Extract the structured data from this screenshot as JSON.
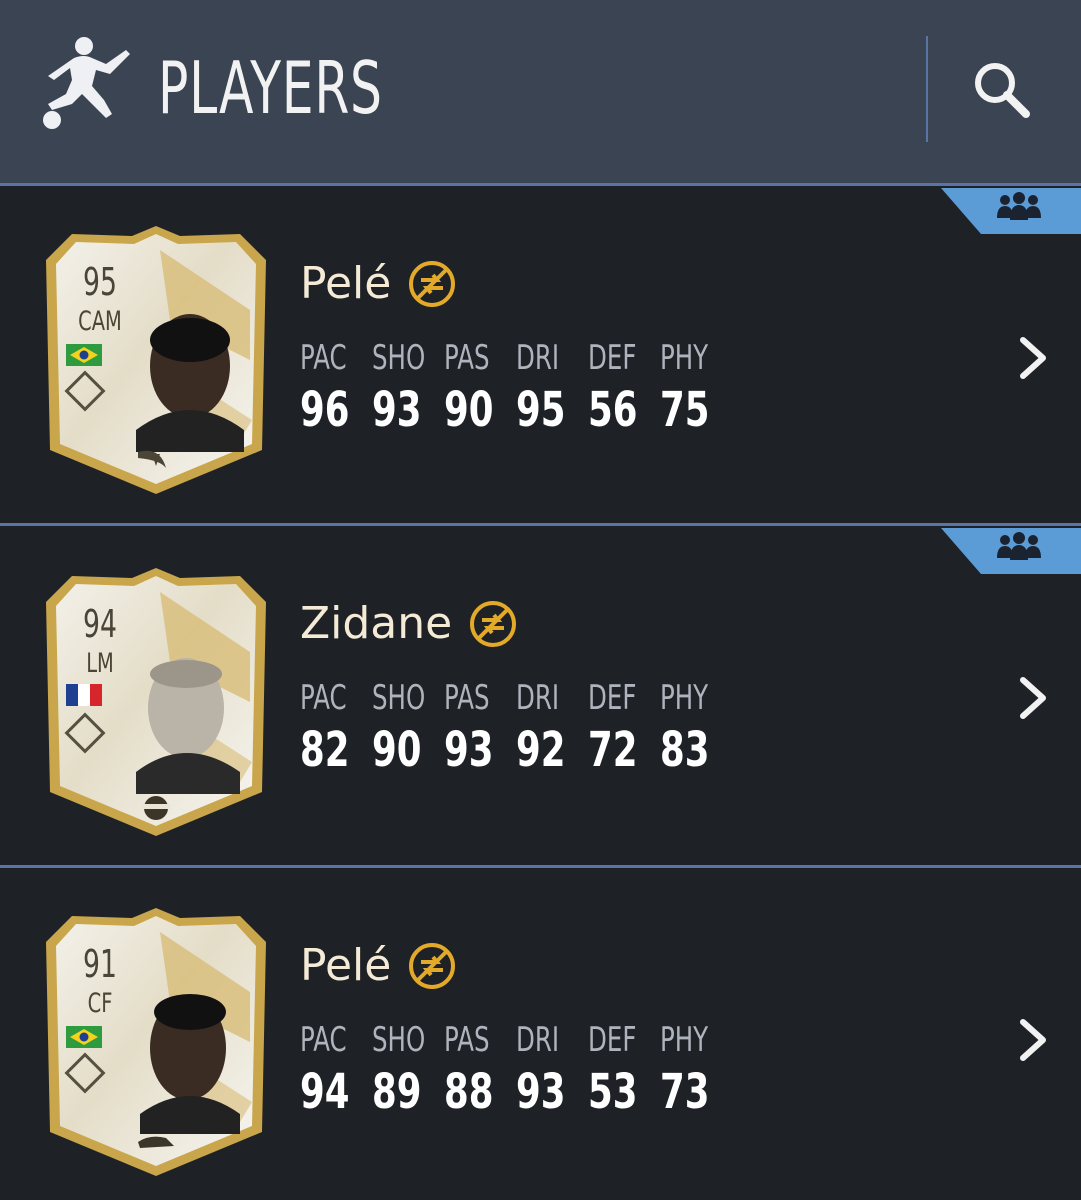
{
  "header": {
    "title": "PLAYERS",
    "logo_icon": "football-player-icon",
    "search_icon": "search-icon"
  },
  "colors": {
    "header_bg": "#3b4452",
    "row_bg": "#1e2126",
    "accent": "#5b74a6",
    "tag_blue": "#5b9bd6",
    "untradeable_gold": "#e3a928",
    "card_gold": "#c9a54c"
  },
  "stat_labels": [
    "PAC",
    "SHO",
    "PAS",
    "DRI",
    "DEF",
    "PHY"
  ],
  "players": [
    {
      "name": "Pelé",
      "rating": "95",
      "position": "CAM",
      "nation": "Brazil",
      "stats": [
        "96",
        "93",
        "90",
        "95",
        "56",
        "75"
      ]
    },
    {
      "name": "Zidane",
      "rating": "94",
      "position": "LM",
      "nation": "France",
      "stats": [
        "82",
        "90",
        "93",
        "92",
        "72",
        "83"
      ]
    },
    {
      "name": "Pelé",
      "rating": "91",
      "position": "CF",
      "nation": "Brazil",
      "stats": [
        "94",
        "89",
        "88",
        "93",
        "53",
        "73"
      ]
    }
  ]
}
